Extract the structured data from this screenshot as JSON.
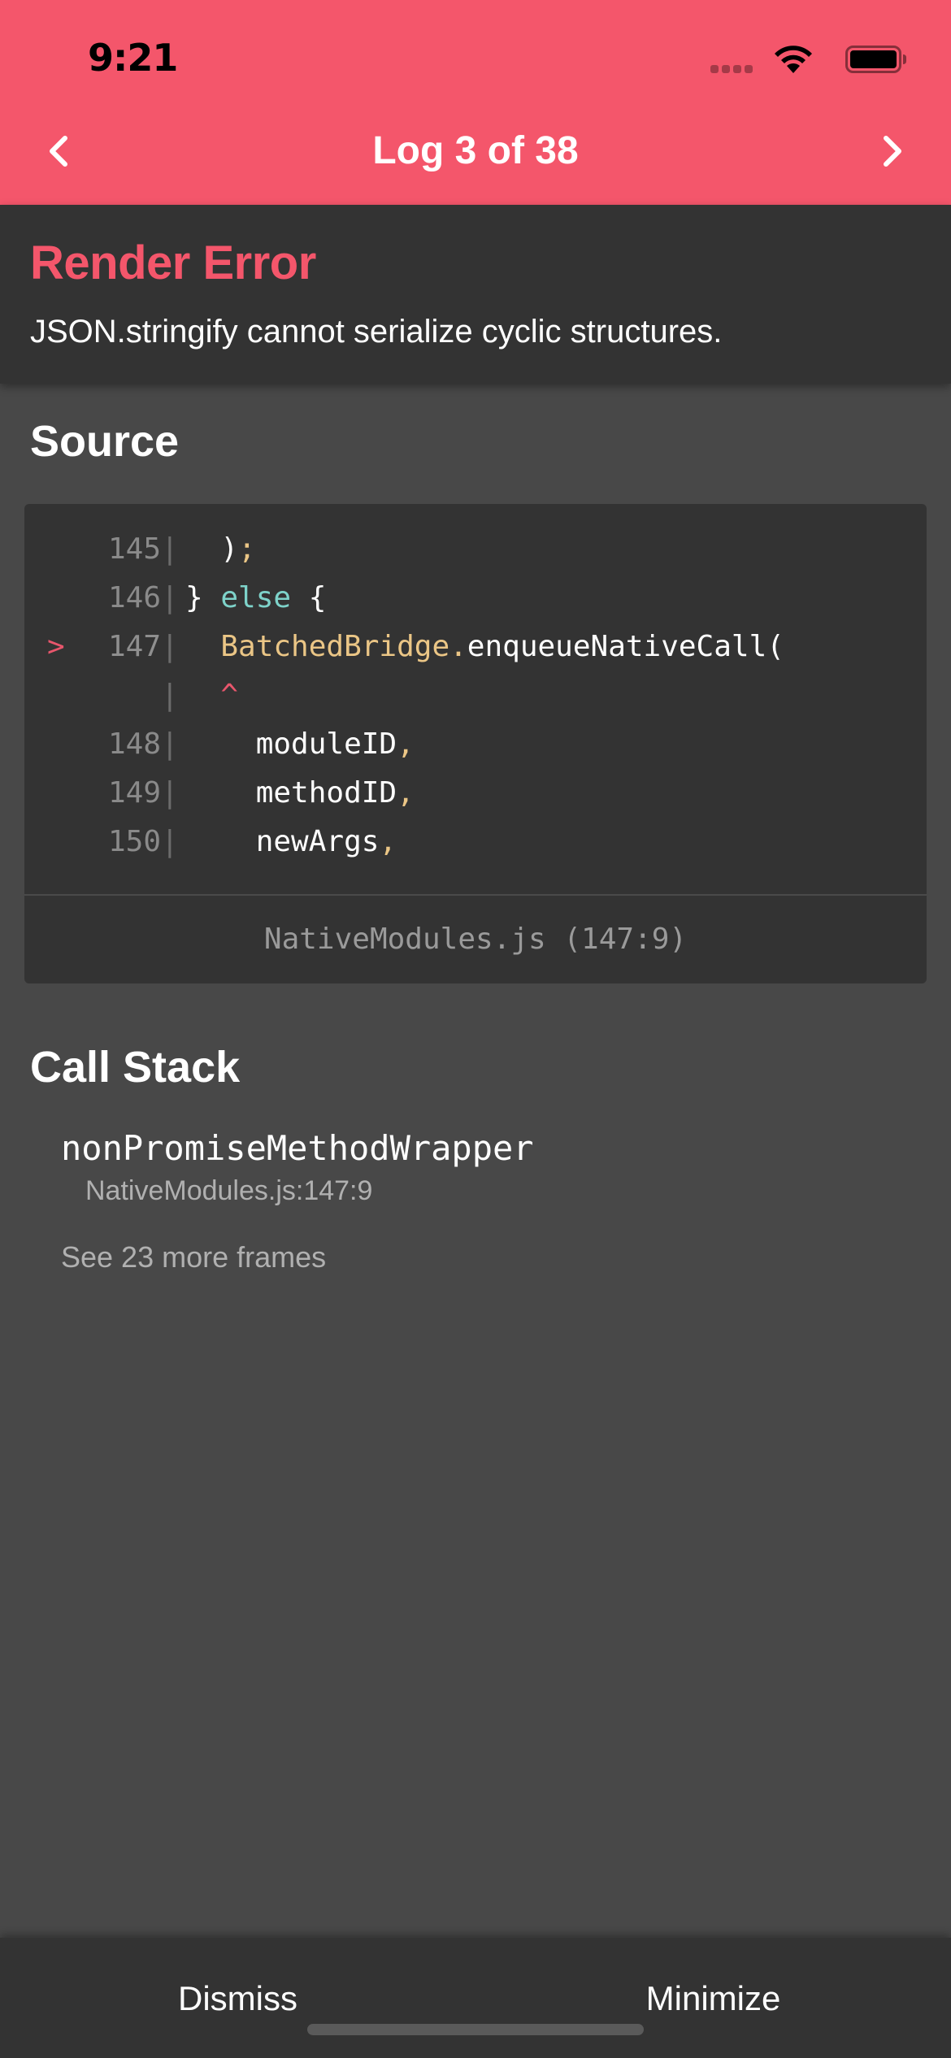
{
  "status_bar": {
    "time": "9:21"
  },
  "nav": {
    "title": "Log 3 of 38"
  },
  "error": {
    "title": "Render Error",
    "message": "JSON.stringify cannot serialize cyclic structures."
  },
  "source": {
    "heading": "Source",
    "lines": [
      {
        "marker": "",
        "number": "145",
        "pipe": "|",
        "indent": "  ",
        "segments": [
          {
            "text": ");",
            "kind": "mixed"
          }
        ]
      },
      {
        "marker": "",
        "number": "146",
        "pipe": "|",
        "indent": "",
        "segments": [
          {
            "text": "} ",
            "kind": "plain"
          },
          {
            "text": "else",
            "kind": "kw"
          },
          {
            "text": " {",
            "kind": "plain"
          }
        ]
      },
      {
        "marker": ">",
        "number": "147",
        "pipe": "|",
        "indent": "  ",
        "segments": [
          {
            "text": "BatchedBridge.",
            "kind": "id"
          },
          {
            "text": "enqueueNativeCall(",
            "kind": "plain"
          }
        ]
      },
      {
        "marker": "",
        "number": "",
        "pipe": "|",
        "indent": "  ",
        "segments": [
          {
            "text": "^",
            "kind": "caret"
          }
        ]
      },
      {
        "marker": "",
        "number": "148",
        "pipe": "|",
        "indent": "    ",
        "segments": [
          {
            "text": "moduleID",
            "kind": "plain"
          },
          {
            "text": ",",
            "kind": "punct"
          }
        ]
      },
      {
        "marker": "",
        "number": "149",
        "pipe": "|",
        "indent": "    ",
        "segments": [
          {
            "text": "methodID",
            "kind": "plain"
          },
          {
            "text": ",",
            "kind": "punct"
          }
        ]
      },
      {
        "marker": "",
        "number": "150",
        "pipe": "|",
        "indent": "    ",
        "segments": [
          {
            "text": "newArgs",
            "kind": "plain"
          },
          {
            "text": ",",
            "kind": "punct"
          }
        ]
      }
    ],
    "file_location": "NativeModules.js (147:9)"
  },
  "call_stack": {
    "heading": "Call Stack",
    "frames": [
      {
        "name": "nonPromiseMethodWrapper",
        "location": "NativeModules.js:147:9"
      }
    ],
    "more_frames_label": "See 23 more frames"
  },
  "footer": {
    "dismiss_label": "Dismiss",
    "minimize_label": "Minimize"
  },
  "colors": {
    "header_bg": "#f4566b",
    "error_accent": "#f4566b",
    "panel_bg": "#333333",
    "page_bg": "#484848"
  }
}
